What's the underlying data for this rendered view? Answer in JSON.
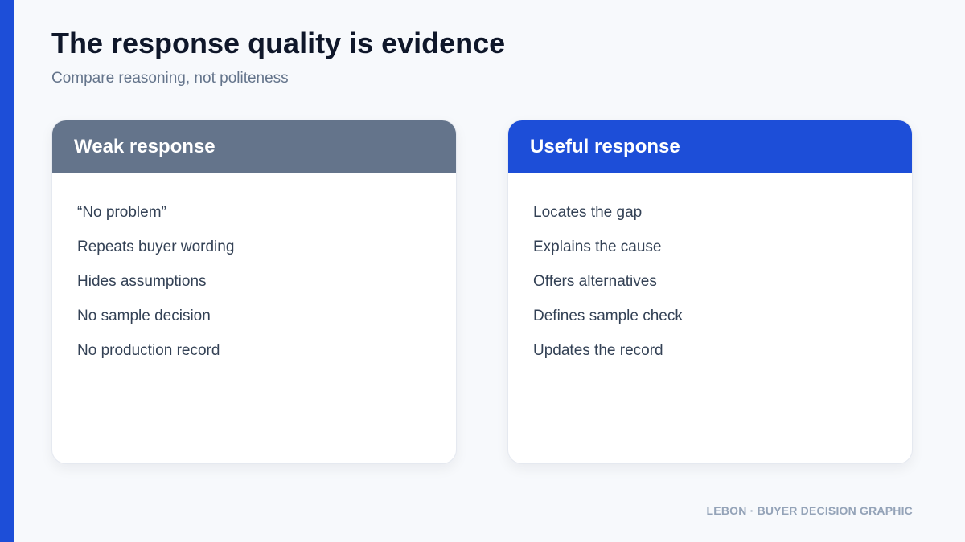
{
  "header": {
    "title": "The response quality is evidence",
    "subtitle": "Compare reasoning, not politeness"
  },
  "cards": [
    {
      "title": "Weak response",
      "items": [
        "“No problem”",
        "Repeats buyer wording",
        "Hides assumptions",
        "No sample decision",
        "No production record"
      ]
    },
    {
      "title": "Useful response",
      "items": [
        "Locates the gap",
        "Explains the cause",
        "Offers alternatives",
        "Defines sample check",
        "Updates the record"
      ]
    }
  ],
  "footer": {
    "text": "LEBON · BUYER DECISION GRAPHIC"
  },
  "colors": {
    "accent": "#1d4ed8",
    "weak_header": "#64748b",
    "useful_header": "#1d4ed8"
  }
}
